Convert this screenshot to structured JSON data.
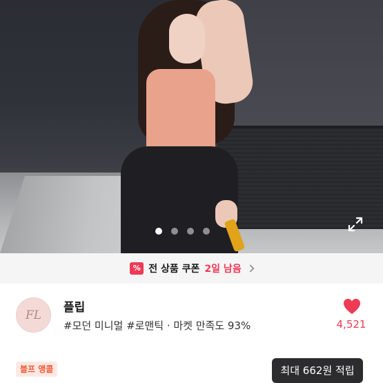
{
  "gallery": {
    "dot_count": 4,
    "active_dot": 1
  },
  "coupon": {
    "text": "전 상품 쿠폰",
    "days": "2일 남음",
    "icon": "percent-coupon-icon",
    "color": "#ee3b55"
  },
  "shop": {
    "logo_text": "FL",
    "name": "플립",
    "tags": "#모던 미니멀 #로맨틱 · 마켓 만족도 93%",
    "likes": "4,521",
    "heart_color": "#ee3b55"
  },
  "bottom": {
    "badge": "블프 앵콜",
    "points_tooltip": "최대 662원 적립"
  }
}
